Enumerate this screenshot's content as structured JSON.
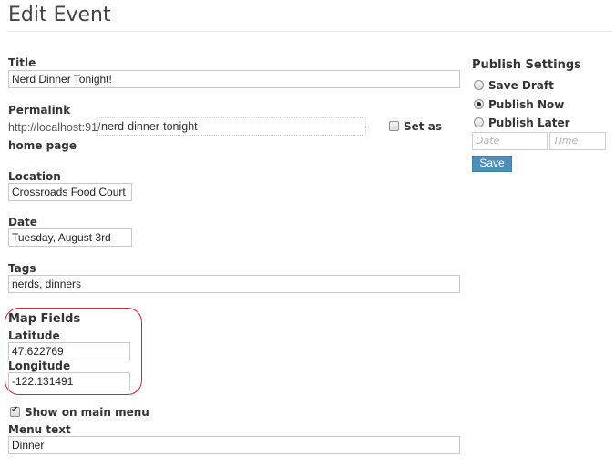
{
  "page": {
    "title": "Edit Event"
  },
  "form": {
    "title": {
      "label": "Title",
      "value": "Nerd Dinner Tonight!"
    },
    "permalink": {
      "label": "Permalink",
      "base": "http://localhost:91/",
      "slug": "nerd-dinner-tonight"
    },
    "homepage": {
      "label_part1": "Set as",
      "label_part2": "home page",
      "checked": false
    },
    "location": {
      "label": "Location",
      "value": "Crossroads Food Court"
    },
    "date": {
      "label": "Date",
      "value": "Tuesday, August 3rd"
    },
    "tags": {
      "label": "Tags",
      "value": "nerds, dinners"
    },
    "map_fields": {
      "heading": "Map Fields",
      "latitude": {
        "label": "Latitude",
        "value": "47.622769"
      },
      "longitude": {
        "label": "Longitude",
        "value": "-122.131491"
      },
      "highlight_color": "#d9232e"
    },
    "show_on_menu": {
      "label": "Show on main menu",
      "checked": true
    },
    "menu_text": {
      "label": "Menu text",
      "value": "Dinner"
    }
  },
  "publish": {
    "heading": "Publish Settings",
    "options": [
      {
        "label": "Save Draft",
        "selected": false
      },
      {
        "label": "Publish Now",
        "selected": true
      },
      {
        "label": "Publish Later",
        "selected": false
      }
    ],
    "date_placeholder": "Date",
    "time_placeholder": "Time",
    "save_label": "Save",
    "button_color": "#4f8eb8"
  }
}
